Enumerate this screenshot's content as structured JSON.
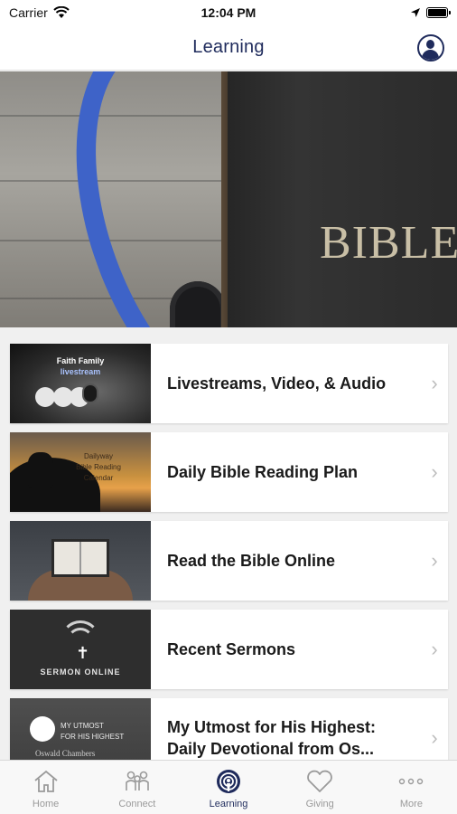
{
  "status_bar": {
    "carrier": "Carrier",
    "time": "12:04 PM"
  },
  "header": {
    "title": "Learning"
  },
  "hero": {
    "label": "BIBLE"
  },
  "items": [
    {
      "title": "Livestreams, Video, & Audio",
      "thumb_line1": "Faith Family",
      "thumb_line2": "livestream"
    },
    {
      "title": "Daily Bible Reading Plan",
      "thumb_line1": "Dailyway",
      "thumb_line2": "Bible Reading",
      "thumb_line3": "Calendar"
    },
    {
      "title": "Read the Bible Online"
    },
    {
      "title": "Recent Sermons",
      "thumb_line1": "SERMON ONLINE"
    },
    {
      "title": "My Utmost for His Highest: Daily Devotional from Os...",
      "thumb_line1": "MY UTMOST",
      "thumb_line2": "FOR HIS HIGHEST",
      "thumb_line3": "Oswald Chambers"
    }
  ],
  "tabs": [
    {
      "label": "Home",
      "icon": "home-icon"
    },
    {
      "label": "Connect",
      "icon": "people-icon"
    },
    {
      "label": "Learning",
      "icon": "podcast-icon",
      "active": true
    },
    {
      "label": "Giving",
      "icon": "heart-icon"
    },
    {
      "label": "More",
      "icon": "more-dots-icon"
    }
  ],
  "colors": {
    "brand": "#1f2b5c",
    "tab_inactive": "#9a9a9a",
    "chevron": "#bdbdbd"
  }
}
